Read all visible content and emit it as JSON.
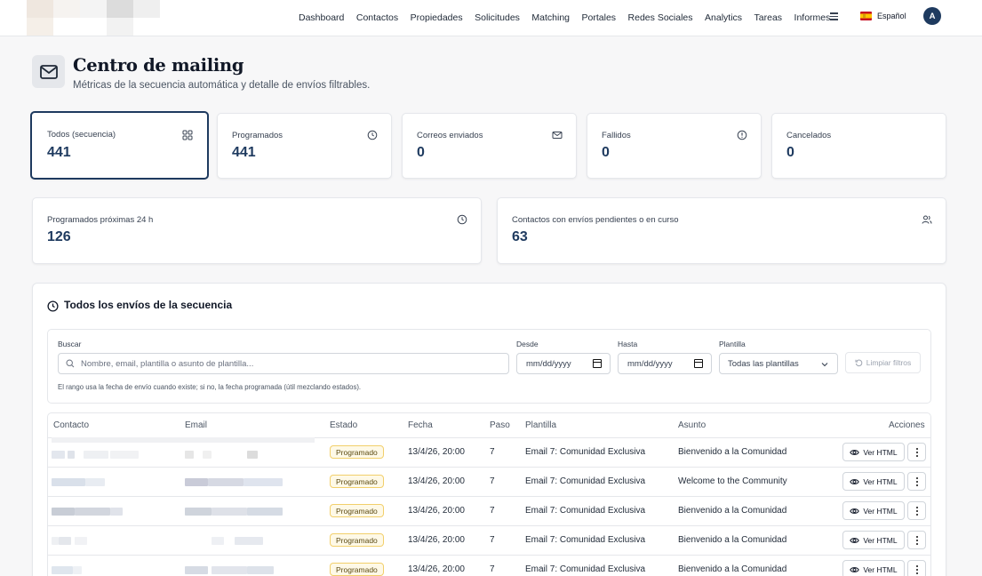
{
  "nav": {
    "items": [
      "Dashboard",
      "Contactos",
      "Propiedades",
      "Solicitudes",
      "Matching",
      "Portales",
      "Redes Sociales",
      "Analytics",
      "Tareas",
      "Informes"
    ],
    "language": "Español",
    "avatar_initial": "A"
  },
  "header": {
    "title": "Centro de mailing",
    "subtitle": "Métricas de la secuencia automática y detalle de envíos filtrables."
  },
  "stats": [
    {
      "label": "Todos (secuencia)",
      "value": "441",
      "icon": "grid-icon"
    },
    {
      "label": "Programados",
      "value": "441",
      "icon": "clock-icon"
    },
    {
      "label": "Correos enviados",
      "value": "0",
      "icon": "mail-icon"
    },
    {
      "label": "Fallidos",
      "value": "0",
      "icon": "alert-icon"
    },
    {
      "label": "Cancelados",
      "value": "0",
      "icon": ""
    }
  ],
  "stats2": [
    {
      "label": "Programados próximas 24 h",
      "value": "126",
      "icon": "clock-icon"
    },
    {
      "label": "Contactos con envíos pendientes o en curso",
      "value": "63",
      "icon": "users-icon"
    }
  ],
  "panel": {
    "title": "Todos los envíos de la secuencia"
  },
  "filters": {
    "search_label": "Buscar",
    "search_placeholder": "Nombre, email, plantilla o asunto de plantilla...",
    "from_label": "Desde",
    "from_value": "mm/dd/yyyy",
    "to_label": "Hasta",
    "to_value": "mm/dd/yyyy",
    "template_label": "Plantilla",
    "template_value": "Todas las plantillas",
    "clear_label": "Limpiar filtros",
    "hint": "El rango usa la fecha de envío cuando existe; si no, la fecha programada (útil mezclando estados)."
  },
  "table": {
    "headers": [
      "Contacto",
      "Email",
      "Estado",
      "Fecha",
      "Paso",
      "Plantilla",
      "Asunto",
      "Acciones"
    ],
    "rows": [
      {
        "estado": "Programado",
        "fecha": "13/4/26, 20:00",
        "paso": "7",
        "plantilla": "Email 7: Comunidad Exclusiva",
        "asunto": "Bienvenido a la Comunidad"
      },
      {
        "estado": "Programado",
        "fecha": "13/4/26, 20:00",
        "paso": "7",
        "plantilla": "Email 7: Comunidad Exclusiva",
        "asunto": "Welcome to the Community"
      },
      {
        "estado": "Programado",
        "fecha": "13/4/26, 20:00",
        "paso": "7",
        "plantilla": "Email 7: Comunidad Exclusiva",
        "asunto": "Bienvenido a la Comunidad"
      },
      {
        "estado": "Programado",
        "fecha": "13/4/26, 20:00",
        "paso": "7",
        "plantilla": "Email 7: Comunidad Exclusiva",
        "asunto": "Bienvenido a la Comunidad"
      },
      {
        "estado": "Programado",
        "fecha": "13/4/26, 20:00",
        "paso": "7",
        "plantilla": "Email 7: Comunidad Exclusiva",
        "asunto": "Bienvenido a la Comunidad"
      }
    ],
    "view_html_label": "Ver HTML"
  },
  "colors": {
    "accent": "#1e3a5f",
    "badge_bg": "#fef9e7",
    "badge_border": "#f2cf6b"
  }
}
